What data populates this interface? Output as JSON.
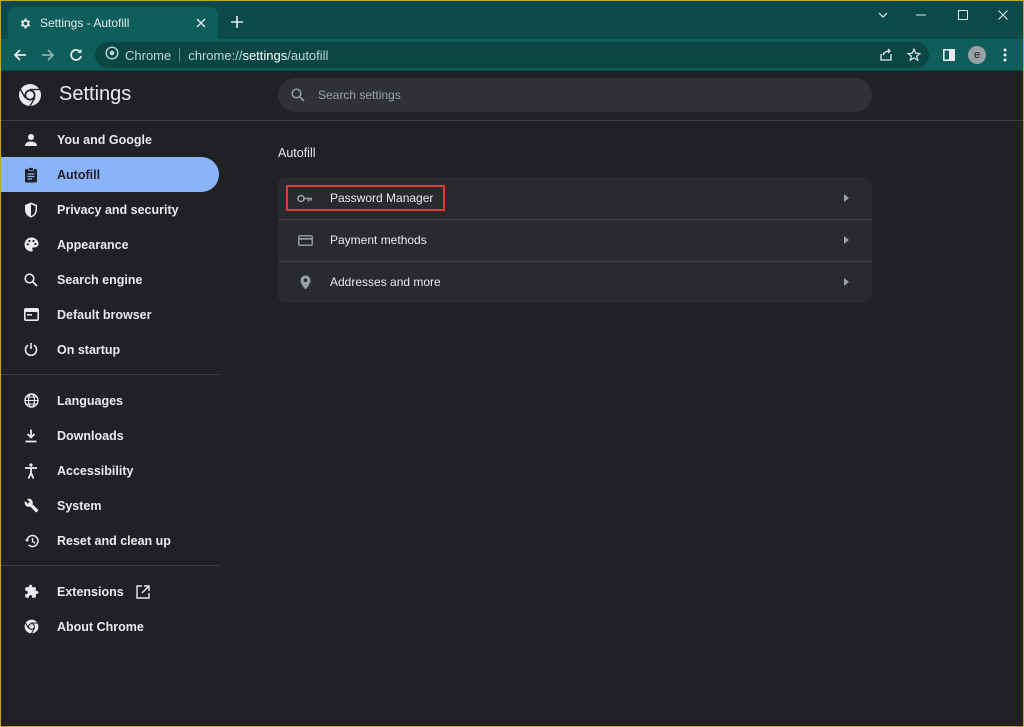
{
  "browser": {
    "tab_title": "Settings - Autofill",
    "omnibox_chrome_label": "Chrome",
    "url_prefix": "chrome://",
    "url_highlight": "settings",
    "url_suffix": "/autofill",
    "avatar_letter": "e"
  },
  "header": {
    "title": "Settings",
    "search_placeholder": "Search settings"
  },
  "sidebar": {
    "items": [
      {
        "label": "You and Google",
        "icon": "person-icon"
      },
      {
        "label": "Autofill",
        "icon": "clipboard-icon",
        "active": true
      },
      {
        "label": "Privacy and security",
        "icon": "shield-icon"
      },
      {
        "label": "Appearance",
        "icon": "palette-icon"
      },
      {
        "label": "Search engine",
        "icon": "search-icon"
      },
      {
        "label": "Default browser",
        "icon": "browser-window-icon"
      },
      {
        "label": "On startup",
        "icon": "power-icon"
      },
      {
        "label": "Languages",
        "icon": "globe-icon"
      },
      {
        "label": "Downloads",
        "icon": "download-icon"
      },
      {
        "label": "Accessibility",
        "icon": "accessibility-icon"
      },
      {
        "label": "System",
        "icon": "wrench-icon"
      },
      {
        "label": "Reset and clean up",
        "icon": "history-icon"
      },
      {
        "label": "Extensions",
        "icon": "puzzle-icon"
      },
      {
        "label": "About Chrome",
        "icon": "chrome-logo-icon"
      }
    ]
  },
  "main": {
    "section_title": "Autofill",
    "rows": [
      {
        "label": "Password Manager",
        "icon": "key-icon"
      },
      {
        "label": "Payment methods",
        "icon": "credit-card-icon"
      },
      {
        "label": "Addresses and more",
        "icon": "location-pin-icon"
      }
    ]
  },
  "colors": {
    "accent": "#8ab4f8",
    "highlight_box": "#e53935",
    "tab_bar": "#0b4a48",
    "toolbar": "#0e5f5b"
  }
}
